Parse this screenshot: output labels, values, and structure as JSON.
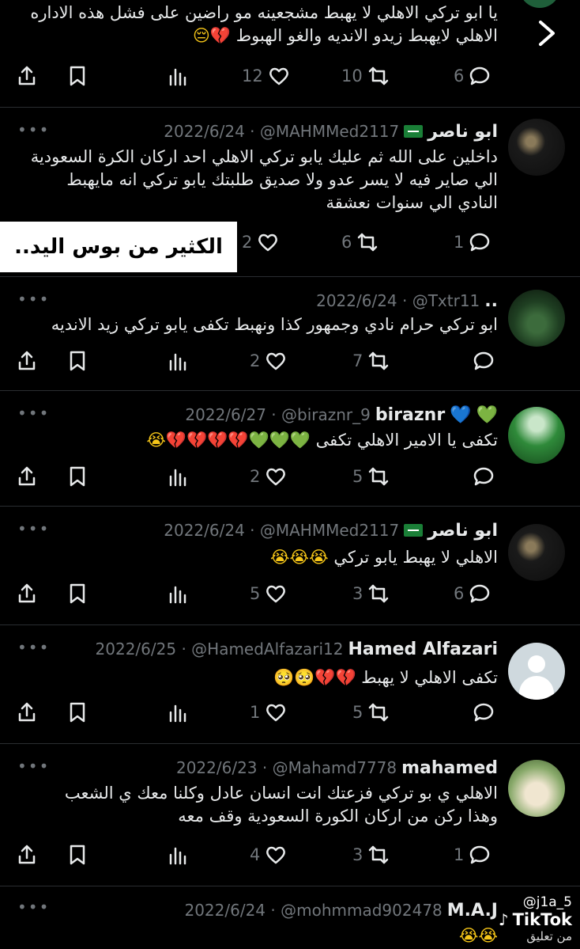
{
  "previous_tweet": {
    "lines": [
      "يا ابو تركي الاهلي لا يهبط مشجعينه مو راضين على فشل هذه الاداره",
      "الاهلي لايهبط زيدو الانديه والغو الهبوط"
    ],
    "counts": {
      "likes": "12",
      "retweets": "10",
      "replies": "6"
    }
  },
  "caption": "الكثير من بوس اليد..",
  "tweets": [
    {
      "name": "ابو ناصر",
      "has_flag": true,
      "handle_date": "2022/6/24 · @MAHMMed2117",
      "lines": [
        "داخلين على الله ثم عليك يابو تركي الاهلي احد اركان الكرة السعودية",
        "الي صاير فيه لا يسر عدو ولا صديق طلبتك يابو تركي انه مايهبط",
        "النادي الي سنوات نعشقة"
      ],
      "counts": {
        "likes": "2",
        "retweets": "6",
        "replies": "1"
      }
    },
    {
      "name": "..",
      "has_flag": false,
      "handle_date": "2022/6/24 · @Txtr11",
      "lines": [
        "ابو تركي حرام نادي وجمهور كذا ونهبط تكفى يابو تركي زيد الانديه"
      ],
      "counts": {
        "likes": "2",
        "retweets": "7",
        "replies": ""
      }
    },
    {
      "name": "biraznr",
      "has_flag": false,
      "handle_date": "2022/6/27 · @biraznr_9",
      "lines": [
        "تكفى يا الامير الاهلي تكفى"
      ],
      "counts": {
        "likes": "2",
        "retweets": "5",
        "replies": ""
      }
    },
    {
      "name": "ابو ناصر",
      "has_flag": true,
      "handle_date": "2022/6/24 · @MAHMMed2117",
      "lines": [
        "الاهلي لا يهبط يابو تركي"
      ],
      "counts": {
        "likes": "5",
        "retweets": "3",
        "replies": "6"
      }
    },
    {
      "name": "Hamed Alfazari",
      "has_flag": false,
      "handle_date": "2022/6/25 · @HamedAlfazari12",
      "lines": [
        "تكفى الاهلي لا يهبط"
      ],
      "counts": {
        "likes": "1",
        "retweets": "5",
        "replies": ""
      }
    },
    {
      "name": "mahamed",
      "has_flag": false,
      "handle_date": "2022/6/23 · @Mahamd7778",
      "lines": [
        "الاهلي ي بو تركي فزعتك انت انسان عادل وكلنا معك ي الشعب",
        "وهذا ركن من اركان الكورة السعودية وقف معه"
      ],
      "counts": {
        "likes": "4",
        "retweets": "3",
        "replies": "1"
      }
    },
    {
      "name": "M.A.J",
      "has_flag": false,
      "handle_date": "2022/6/24 · @mohmmad902478",
      "lines": [],
      "counts": {
        "likes": "",
        "retweets": "",
        "replies": ""
      }
    }
  ],
  "watermark": {
    "brand": "TikTok",
    "handle": "@j1a_5",
    "sub": "من تعليق"
  },
  "colors": {
    "background": "#000000",
    "text": "#e7e9ea",
    "muted": "#71767b",
    "broken_heart": "#e0245e",
    "green_heart": "#3fb950"
  },
  "icons": [
    "share-icon",
    "bookmark-icon",
    "views-icon",
    "like-icon",
    "retweet-icon",
    "reply-icon",
    "more-icon",
    "chevron-right-icon"
  ]
}
